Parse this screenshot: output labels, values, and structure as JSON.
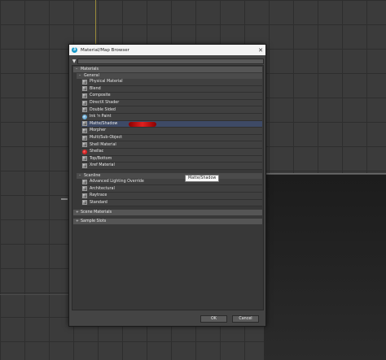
{
  "window": {
    "title": "Material/Map Browser",
    "app_icon": "3",
    "close_label": "✕"
  },
  "search": {
    "value": "",
    "placeholder": ""
  },
  "sections": {
    "materials": "Materials",
    "general": "General",
    "scanline": "Scanline",
    "scene_materials": "Scene Materials",
    "sample_slots": "Sample Slots"
  },
  "general_items": [
    {
      "label": "Physical Material",
      "icon": "material-sphere-icon"
    },
    {
      "label": "Blend",
      "icon": "material-sphere-icon"
    },
    {
      "label": "Composite",
      "icon": "material-sphere-icon"
    },
    {
      "label": "DirectX Shader",
      "icon": "material-sphere-icon"
    },
    {
      "label": "Double Sided",
      "icon": "material-sphere-icon"
    },
    {
      "label": "Ink 'n Paint",
      "icon": "ink-paint-icon"
    },
    {
      "label": "Matte/Shadow",
      "icon": "material-sphere-icon"
    },
    {
      "label": "Morpher",
      "icon": "material-sphere-icon"
    },
    {
      "label": "Multi/Sub-Object",
      "icon": "material-sphere-icon"
    },
    {
      "label": "Shell Material",
      "icon": "material-sphere-icon"
    },
    {
      "label": "Shellac",
      "icon": "shellac-icon"
    },
    {
      "label": "Top/Bottom",
      "icon": "material-sphere-icon"
    },
    {
      "label": "Xref Material",
      "icon": "material-sphere-icon"
    }
  ],
  "scanline_items": [
    {
      "label": "Advanced Lighting Override"
    },
    {
      "label": "Architectural"
    },
    {
      "label": "Raytrace"
    },
    {
      "label": "Standard"
    }
  ],
  "tooltip": "Matte/Shadow",
  "buttons": {
    "ok": "OK",
    "cancel": "Cancel"
  },
  "colors": {
    "selected_row": "#3e4a66",
    "title_bar": "#f3f3f3",
    "accent_red": "#e02020"
  }
}
